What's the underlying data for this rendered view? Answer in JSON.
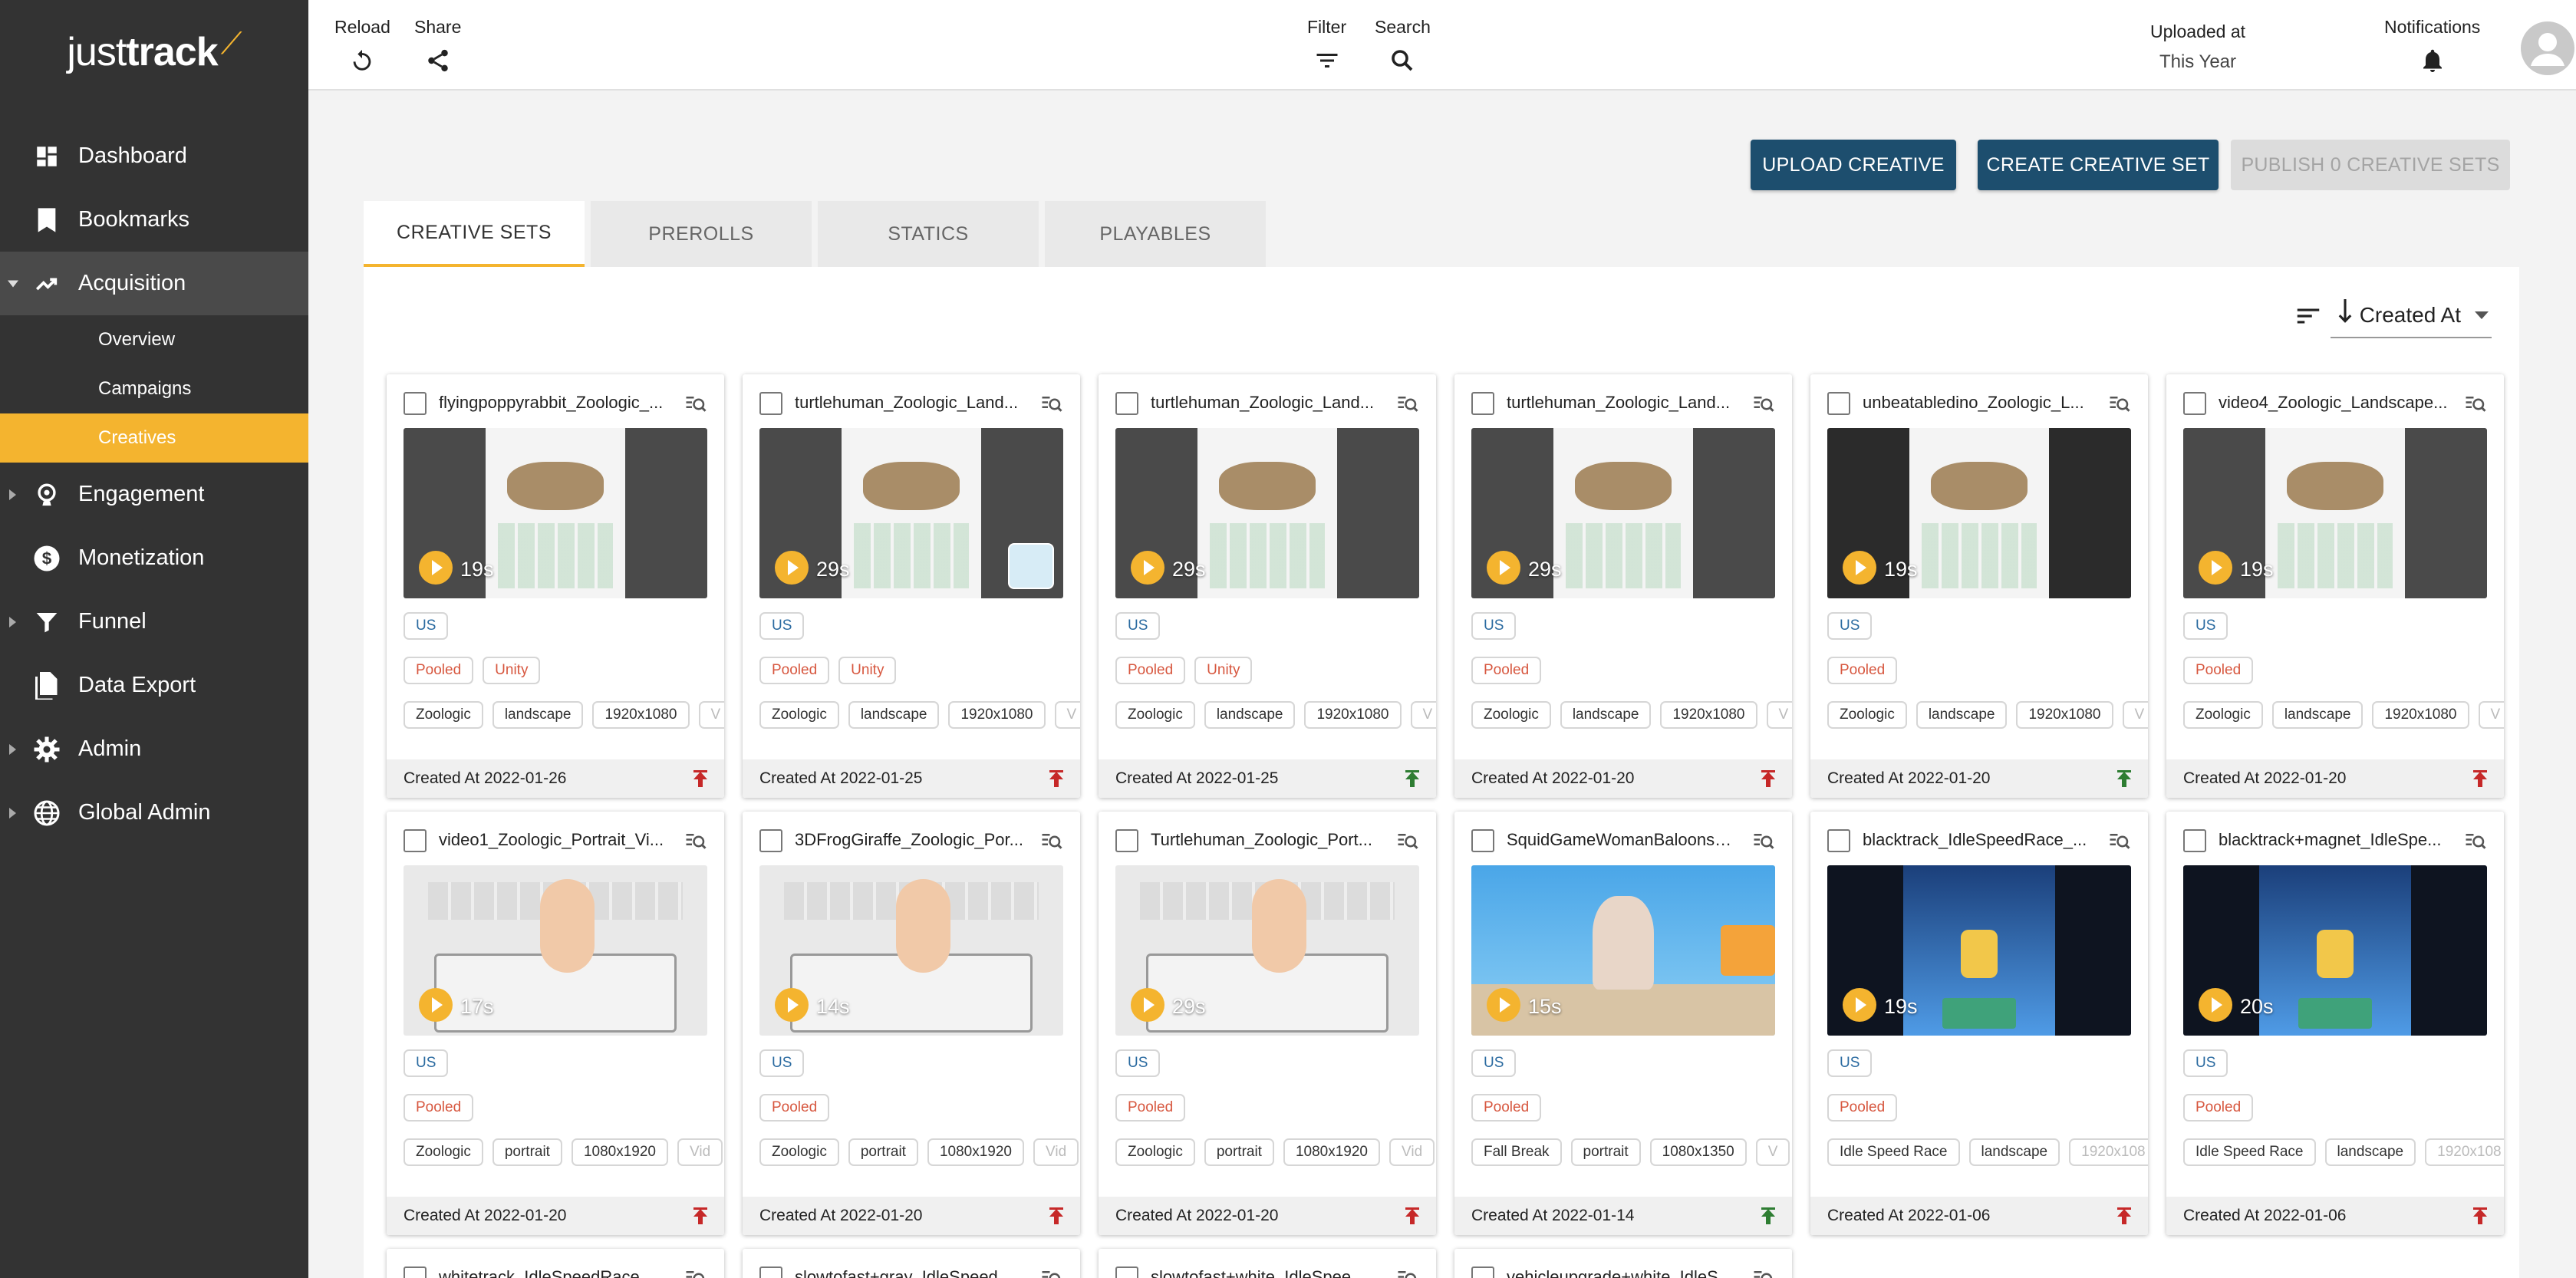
{
  "logo": {
    "part1": "just",
    "part2": "track"
  },
  "sidebar": {
    "items": [
      {
        "label": "Dashboard",
        "icon": "dashboard-icon"
      },
      {
        "label": "Bookmarks",
        "icon": "bookmark-icon"
      },
      {
        "label": "Acquisition",
        "icon": "trending-up-icon",
        "open": true,
        "sub": [
          {
            "label": "Overview"
          },
          {
            "label": "Campaigns"
          },
          {
            "label": "Creatives",
            "active": true
          }
        ]
      },
      {
        "label": "Engagement",
        "icon": "engagement-icon"
      },
      {
        "label": "Monetization",
        "icon": "dollar-icon"
      },
      {
        "label": "Funnel",
        "icon": "funnel-icon"
      },
      {
        "label": "Data Export",
        "icon": "document-icon"
      },
      {
        "label": "Admin",
        "icon": "gear-icon"
      },
      {
        "label": "Global Admin",
        "icon": "globe-icon"
      }
    ]
  },
  "topbar": {
    "reload": "Reload",
    "share": "Share",
    "filter": "Filter",
    "search": "Search",
    "uploaded_label": "Uploaded at",
    "uploaded_value": "This Year",
    "notifications": "Notifications"
  },
  "actions": {
    "upload": "UPLOAD CREATIVE",
    "create": "CREATE CREATIVE SET",
    "publish": "PUBLISH 0 CREATIVE SETS"
  },
  "tabs": [
    "CREATIVE SETS",
    "PREROLLS",
    "STATICS",
    "PLAYABLES"
  ],
  "sort": {
    "label": "Created At"
  },
  "colors": {
    "accent": "#f4b42f",
    "primary": "#1d4e6e",
    "sidebar": "#333333",
    "upload_red": "#c62828",
    "upload_green": "#2e7d32"
  },
  "cards": [
    {
      "title": "flyingpoppyrabbit_Zoologic_...",
      "duration": "19s",
      "geo": "US",
      "pool": [
        "Pooled",
        "Unity"
      ],
      "tags": [
        "Zoologic",
        "landscape",
        "1920x1080",
        "V"
      ],
      "date": "Created At 2022-01-26",
      "status": "red",
      "thumb": "zoo"
    },
    {
      "title": "turtlehuman_Zoologic_Land...",
      "duration": "29s",
      "geo": "US",
      "pool": [
        "Pooled",
        "Unity"
      ],
      "tags": [
        "Zoologic",
        "landscape",
        "1920x1080",
        "V"
      ],
      "date": "Created At 2022-01-25",
      "status": "red",
      "thumb": "zoo2"
    },
    {
      "title": "turtlehuman_Zoologic_Land...",
      "duration": "29s",
      "geo": "US",
      "pool": [
        "Pooled",
        "Unity"
      ],
      "tags": [
        "Zoologic",
        "landscape",
        "1920x1080",
        "V"
      ],
      "date": "Created At 2022-01-25",
      "status": "green",
      "thumb": "zoo"
    },
    {
      "title": "turtlehuman_Zoologic_Land...",
      "duration": "29s",
      "geo": "US",
      "pool": [
        "Pooled"
      ],
      "tags": [
        "Zoologic",
        "landscape",
        "1920x1080",
        "V"
      ],
      "date": "Created At 2022-01-20",
      "status": "red",
      "thumb": "zoo"
    },
    {
      "title": "unbeatabledino_Zoologic_L...",
      "duration": "19s",
      "geo": "US",
      "pool": [
        "Pooled"
      ],
      "tags": [
        "Zoologic",
        "landscape",
        "1920x1080",
        "V"
      ],
      "date": "Created At 2022-01-20",
      "status": "green",
      "thumb": "zoodark"
    },
    {
      "title": "video4_Zoologic_Landscape...",
      "duration": "19s",
      "geo": "US",
      "pool": [
        "Pooled"
      ],
      "tags": [
        "Zoologic",
        "landscape",
        "1920x1080",
        "V"
      ],
      "date": "Created At 2022-01-20",
      "status": "red",
      "thumb": "zoo"
    },
    {
      "title": "video1_Zoologic_Portrait_Vi...",
      "duration": "17s",
      "geo": "US",
      "pool": [
        "Pooled"
      ],
      "tags": [
        "Zoologic",
        "portrait",
        "1080x1920",
        "Vid"
      ],
      "date": "Created At 2022-01-20",
      "status": "red",
      "thumb": "light"
    },
    {
      "title": "3DFrogGiraffe_Zoologic_Por...",
      "duration": "14s",
      "geo": "US",
      "pool": [
        "Pooled"
      ],
      "tags": [
        "Zoologic",
        "portrait",
        "1080x1920",
        "Vid"
      ],
      "date": "Created At 2022-01-20",
      "status": "red",
      "thumb": "light"
    },
    {
      "title": "Turtlehuman_Zoologic_Port...",
      "duration": "29s",
      "geo": "US",
      "pool": [
        "Pooled"
      ],
      "tags": [
        "Zoologic",
        "portrait",
        "1080x1920",
        "Vid"
      ],
      "date": "Created At 2022-01-20",
      "status": "red",
      "thumb": "light"
    },
    {
      "title": "SquidGameWomanBaloons_...",
      "duration": "15s",
      "geo": "US",
      "pool": [
        "Pooled"
      ],
      "tags": [
        "Fall Break",
        "portrait",
        "1080x1350",
        "V"
      ],
      "date": "Created At 2022-01-14",
      "status": "green",
      "thumb": "sky"
    },
    {
      "title": "blacktrack_IdleSpeedRace_...",
      "duration": "19s",
      "geo": "US",
      "pool": [
        "Pooled"
      ],
      "tags": [
        "Idle Speed Race",
        "landscape",
        "1920x108"
      ],
      "date": "Created At 2022-01-06",
      "status": "red",
      "thumb": "race"
    },
    {
      "title": "blacktrack+magnet_IdleSpe...",
      "duration": "20s",
      "geo": "US",
      "pool": [
        "Pooled"
      ],
      "tags": [
        "Idle Speed Race",
        "landscape",
        "1920x108"
      ],
      "date": "Created At 2022-01-06",
      "status": "red",
      "thumb": "race"
    }
  ],
  "partial_cards": [
    {
      "title": "whitetrack_IdleSpeedRace_..."
    },
    {
      "title": "slowtofast+gray_IdleSpeed..."
    },
    {
      "title": "slowtofast+white_IdleSpee..."
    },
    {
      "title": "vehicleupgrade+white_IdleS..."
    }
  ]
}
